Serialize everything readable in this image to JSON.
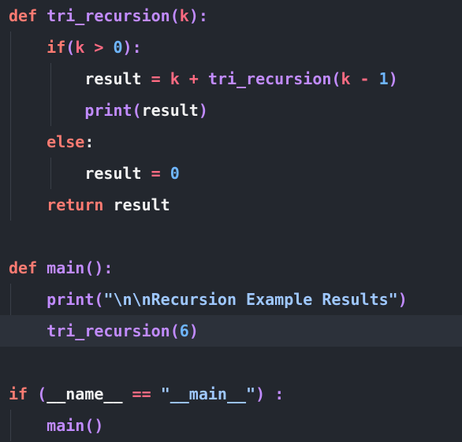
{
  "editor": {
    "colors": {
      "background": "#23272e",
      "active_line": "#2c313a",
      "keyword": "#ff7b72",
      "function": "#c18bff",
      "number": "#6fb6ff",
      "string": "#9fc8ff",
      "operator": "#ff6b82"
    },
    "lines": [
      {
        "indent": "",
        "tokens": [
          {
            "t": "def",
            "c": "kw"
          },
          {
            "t": " ",
            "c": "pl"
          },
          {
            "t": "tri_recursion",
            "c": "fn"
          },
          {
            "t": "(",
            "c": "par"
          },
          {
            "t": "k",
            "c": "op"
          },
          {
            "t": "):",
            "c": "par"
          }
        ]
      },
      {
        "indent": "    ",
        "tokens": [
          {
            "t": "if",
            "c": "kw"
          },
          {
            "t": "(",
            "c": "par"
          },
          {
            "t": "k",
            "c": "op"
          },
          {
            "t": " > ",
            "c": "op"
          },
          {
            "t": "0",
            "c": "num"
          },
          {
            "t": "):",
            "c": "par"
          }
        ]
      },
      {
        "indent": "        ",
        "tokens": [
          {
            "t": "result",
            "c": "id"
          },
          {
            "t": " = ",
            "c": "op"
          },
          {
            "t": "k",
            "c": "op"
          },
          {
            "t": " + ",
            "c": "op"
          },
          {
            "t": "tri_recursion",
            "c": "fn"
          },
          {
            "t": "(",
            "c": "par"
          },
          {
            "t": "k",
            "c": "op"
          },
          {
            "t": " - ",
            "c": "op"
          },
          {
            "t": "1",
            "c": "num"
          },
          {
            "t": ")",
            "c": "par"
          }
        ]
      },
      {
        "indent": "        ",
        "tokens": [
          {
            "t": "print",
            "c": "fn"
          },
          {
            "t": "(",
            "c": "par"
          },
          {
            "t": "result",
            "c": "id"
          },
          {
            "t": ")",
            "c": "par"
          }
        ]
      },
      {
        "indent": "    ",
        "tokens": [
          {
            "t": "else",
            "c": "kw"
          },
          {
            "t": ":",
            "c": "pl"
          }
        ]
      },
      {
        "indent": "        ",
        "tokens": [
          {
            "t": "result",
            "c": "id"
          },
          {
            "t": " = ",
            "c": "op"
          },
          {
            "t": "0",
            "c": "num"
          }
        ]
      },
      {
        "indent": "    ",
        "tokens": [
          {
            "t": "return",
            "c": "kw"
          },
          {
            "t": " ",
            "c": "pl"
          },
          {
            "t": "result",
            "c": "id"
          }
        ]
      },
      {
        "indent": "",
        "tokens": []
      },
      {
        "indent": "",
        "tokens": [
          {
            "t": "def",
            "c": "kw"
          },
          {
            "t": " ",
            "c": "pl"
          },
          {
            "t": "main",
            "c": "fn"
          },
          {
            "t": "():",
            "c": "par"
          }
        ]
      },
      {
        "indent": "    ",
        "tokens": [
          {
            "t": "print",
            "c": "fn"
          },
          {
            "t": "(",
            "c": "par"
          },
          {
            "t": "\"\\n\\nRecursion Example Results\"",
            "c": "str"
          },
          {
            "t": ")",
            "c": "par"
          }
        ]
      },
      {
        "indent": "    ",
        "active": true,
        "tokens": [
          {
            "t": "tri_recursion",
            "c": "fn"
          },
          {
            "t": "(",
            "c": "par"
          },
          {
            "t": "6",
            "c": "num"
          },
          {
            "t": ")",
            "c": "par"
          }
        ]
      },
      {
        "indent": "",
        "tokens": []
      },
      {
        "indent": "",
        "tokens": [
          {
            "t": "if",
            "c": "kw"
          },
          {
            "t": " (",
            "c": "par"
          },
          {
            "t": "__name__",
            "c": "id"
          },
          {
            "t": " == ",
            "c": "op"
          },
          {
            "t": "\"__main__\"",
            "c": "str"
          },
          {
            "t": ") :",
            "c": "par"
          }
        ]
      },
      {
        "indent": "    ",
        "tokens": [
          {
            "t": "main",
            "c": "fn"
          },
          {
            "t": "()",
            "c": "par"
          }
        ]
      }
    ]
  }
}
